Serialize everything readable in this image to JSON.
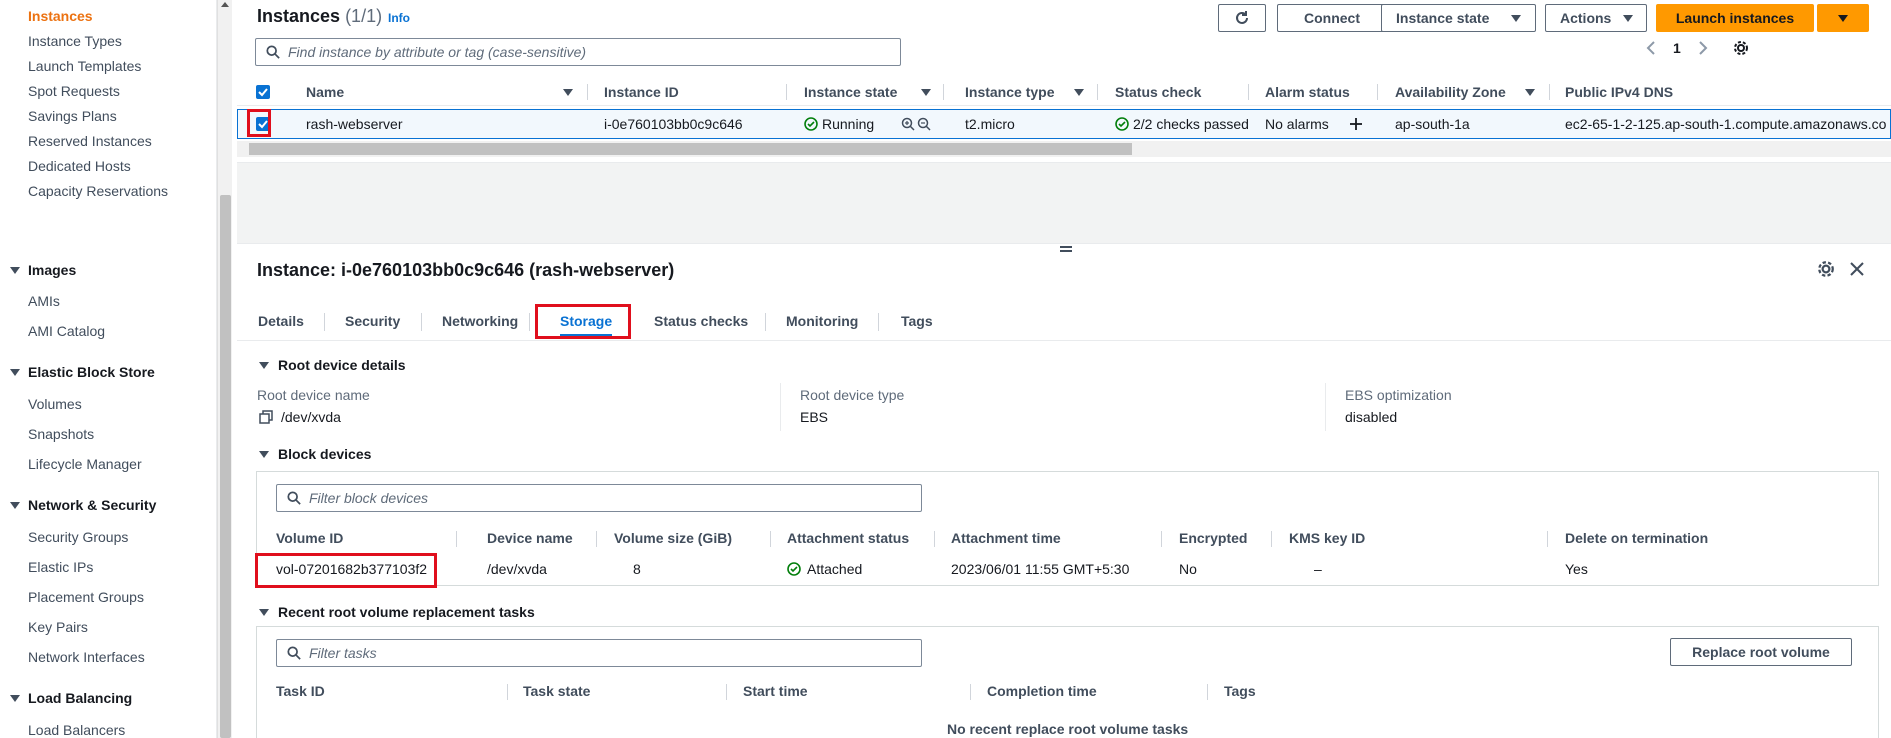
{
  "sidebar": {
    "items": [
      {
        "label": "Instances",
        "active": true
      },
      {
        "label": "Instance Types"
      },
      {
        "label": "Launch Templates"
      },
      {
        "label": "Spot Requests"
      },
      {
        "label": "Savings Plans"
      },
      {
        "label": "Reserved Instances"
      },
      {
        "label": "Dedicated Hosts"
      },
      {
        "label": "Capacity Reservations"
      }
    ],
    "sections": [
      {
        "title": "Images",
        "items": [
          "AMIs",
          "AMI Catalog"
        ]
      },
      {
        "title": "Elastic Block Store",
        "items": [
          "Volumes",
          "Snapshots",
          "Lifecycle Manager"
        ]
      },
      {
        "title": "Network & Security",
        "items": [
          "Security Groups",
          "Elastic IPs",
          "Placement Groups",
          "Key Pairs",
          "Network Interfaces"
        ]
      },
      {
        "title": "Load Balancing",
        "items": [
          "Load Balancers"
        ]
      }
    ]
  },
  "instances": {
    "title": "Instances",
    "count": "(1/1)",
    "info": "Info",
    "buttons": {
      "connect": "Connect",
      "instance_state": "Instance state",
      "actions": "Actions",
      "launch": "Launch instances"
    },
    "search_placeholder": "Find instance by attribute or tag (case-sensitive)",
    "page": "1",
    "columns": [
      "Name",
      "Instance ID",
      "Instance state",
      "Instance type",
      "Status check",
      "Alarm status",
      "Availability Zone",
      "Public IPv4 DNS"
    ],
    "row": {
      "name": "rash-webserver",
      "id": "i-0e760103bb0c9c646",
      "state": "Running",
      "type": "t2.micro",
      "status": "2/2 checks passed",
      "alarm": "No alarms",
      "az": "ap-south-1a",
      "dns": "ec2-65-1-2-125.ap-south-1.compute.amazonaws.co"
    }
  },
  "detail": {
    "title": "Instance: i-0e760103bb0c9c646 (rash-webserver)",
    "tabs": [
      "Details",
      "Security",
      "Networking",
      "Storage",
      "Status checks",
      "Monitoring",
      "Tags"
    ],
    "active_tab": "Storage",
    "root": {
      "heading": "Root device details",
      "name_label": "Root device name",
      "name_value": "/dev/xvda",
      "type_label": "Root device type",
      "type_value": "EBS",
      "ebs_label": "EBS optimization",
      "ebs_value": "disabled"
    },
    "block": {
      "heading": "Block devices",
      "filter_placeholder": "Filter block devices",
      "columns": [
        "Volume ID",
        "Device name",
        "Volume size (GiB)",
        "Attachment status",
        "Attachment time",
        "Encrypted",
        "KMS key ID",
        "Delete on termination"
      ],
      "row": {
        "volume_id": "vol-07201682b377103f2",
        "device": "/dev/xvda",
        "size": "8",
        "status": "Attached",
        "time": "2023/06/01 11:55 GMT+5:30",
        "encrypted": "No",
        "kms": "–",
        "delete": "Yes"
      }
    },
    "tasks": {
      "heading": "Recent root volume replacement tasks",
      "filter_placeholder": "Filter tasks",
      "replace_button": "Replace root volume",
      "columns": [
        "Task ID",
        "Task state",
        "Start time",
        "Completion time",
        "Tags"
      ],
      "empty": "No recent replace root volume tasks"
    }
  },
  "colors": {
    "accent": "#0972d3",
    "primary": "#ff9900",
    "success": "#037f0c",
    "highlight": "#e00f1d",
    "active_nav": "#ec7211"
  }
}
